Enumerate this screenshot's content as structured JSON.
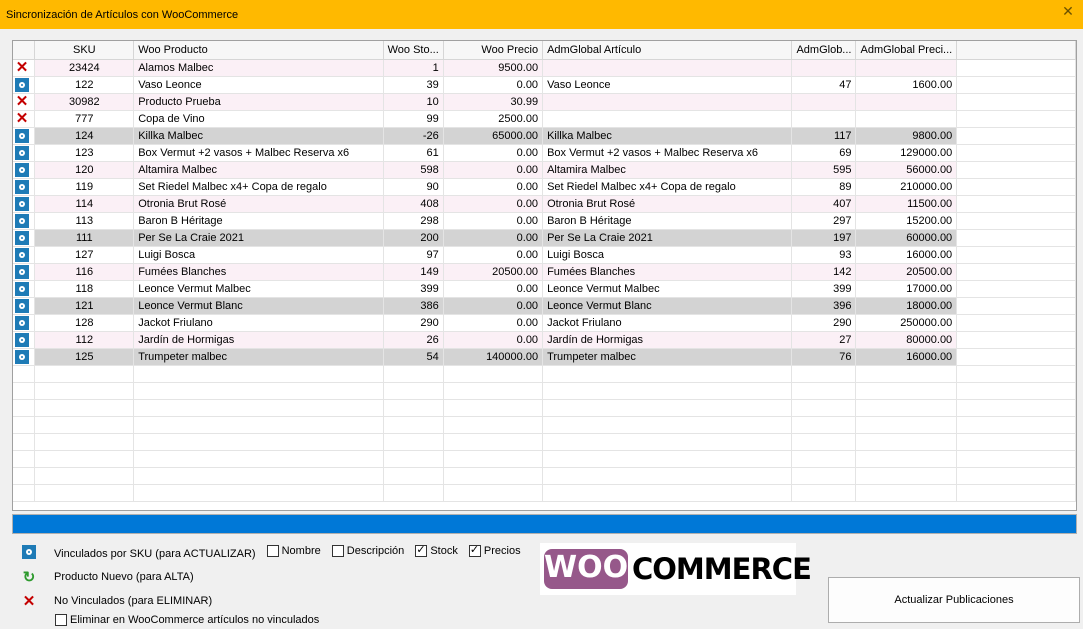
{
  "window": {
    "title": "Sincronización de Artículos con WooCommerce",
    "close": "✕"
  },
  "grid": {
    "headers": [
      "",
      "SKU",
      "Woo Producto",
      "Woo Sto...",
      "Woo Precio",
      "AdmGlobal Artículo",
      "AdmGlob...",
      "AdmGlobal Preci...",
      ""
    ],
    "rows": [
      {
        "icon": "x",
        "style": "pink",
        "cells": [
          "23424",
          "Alamos Malbec",
          "1",
          "9500.00",
          "",
          "",
          ""
        ]
      },
      {
        "icon": "link",
        "style": "white",
        "cells": [
          "122",
          "Vaso Leonce",
          "39",
          "0.00",
          "Vaso Leonce",
          "47",
          "1600.00"
        ]
      },
      {
        "icon": "x",
        "style": "pink",
        "cells": [
          "30982",
          "Producto Prueba",
          "10",
          "30.99",
          "",
          "",
          ""
        ]
      },
      {
        "icon": "x",
        "style": "white",
        "cells": [
          "777",
          "Copa de Vino",
          "99",
          "2500.00",
          "",
          "",
          ""
        ]
      },
      {
        "icon": "link",
        "style": "gray",
        "cells": [
          "124",
          "Killka Malbec",
          "-26",
          "65000.00",
          "Killka Malbec",
          "117",
          "9800.00"
        ]
      },
      {
        "icon": "link",
        "style": "white",
        "cells": [
          "123",
          "Box Vermut +2 vasos + Malbec Reserva x6",
          "61",
          "0.00",
          "Box Vermut +2 vasos + Malbec Reserva x6",
          "69",
          "129000.00"
        ]
      },
      {
        "icon": "link",
        "style": "pink",
        "cells": [
          "120",
          "Altamira Malbec",
          "598",
          "0.00",
          "Altamira Malbec",
          "595",
          "56000.00"
        ]
      },
      {
        "icon": "link",
        "style": "white",
        "cells": [
          "119",
          "Set Riedel Malbec x4+ Copa de regalo",
          "90",
          "0.00",
          "Set Riedel Malbec x4+ Copa de regalo",
          "89",
          "210000.00"
        ]
      },
      {
        "icon": "link",
        "style": "pink",
        "cells": [
          "114",
          "Otronia Brut Rosé",
          "408",
          "0.00",
          "Otronia Brut Rosé",
          "407",
          "11500.00"
        ]
      },
      {
        "icon": "link",
        "style": "white",
        "cells": [
          "113",
          "Baron B Héritage",
          "298",
          "0.00",
          "Baron B Héritage",
          "297",
          "15200.00"
        ]
      },
      {
        "icon": "link",
        "style": "gray",
        "cells": [
          "111",
          "Per Se La Craie 2021",
          "200",
          "0.00",
          "Per Se La Craie 2021",
          "197",
          "60000.00"
        ]
      },
      {
        "icon": "link",
        "style": "white",
        "cells": [
          "127",
          "Luigi Bosca",
          "97",
          "0.00",
          "Luigi Bosca",
          "93",
          "16000.00"
        ]
      },
      {
        "icon": "link",
        "style": "pink",
        "cells": [
          "116",
          "Fumées Blanches",
          "149",
          "20500.00",
          "Fumées Blanches",
          "142",
          "20500.00"
        ]
      },
      {
        "icon": "link",
        "style": "white",
        "cells": [
          "118",
          "Leonce Vermut Malbec",
          "399",
          "0.00",
          "Leonce Vermut Malbec",
          "399",
          "17000.00"
        ]
      },
      {
        "icon": "link",
        "style": "gray",
        "cells": [
          "121",
          "Leonce Vermut Blanc",
          "386",
          "0.00",
          "Leonce Vermut Blanc",
          "396",
          "18000.00"
        ]
      },
      {
        "icon": "link",
        "style": "white",
        "cells": [
          "128",
          "Jackot Friulano",
          "290",
          "0.00",
          "Jackot Friulano",
          "290",
          "250000.00"
        ]
      },
      {
        "icon": "link",
        "style": "pink",
        "cells": [
          "112",
          "Jardín de Hormigas",
          "26",
          "0.00",
          "Jardín de Hormigas",
          "27",
          "80000.00"
        ]
      },
      {
        "icon": "link",
        "style": "gray",
        "cells": [
          "125",
          "Trumpeter malbec",
          "54",
          "140000.00",
          "Trumpeter malbec",
          "76",
          "16000.00"
        ]
      }
    ],
    "empty_rows": 8
  },
  "progress": {
    "percent": 100,
    "color": "#0078d7"
  },
  "legend": {
    "linked": "Vinculados por SKU (para ACTUALIZAR)",
    "new": "Producto Nuevo (para ALTA)",
    "unlinked": "No Vinculados (para ELIMINAR)",
    "delete_option": "Eliminar en WooCommerce artículos no vinculados"
  },
  "options": [
    {
      "label": "Nombre",
      "checked": false
    },
    {
      "label": "Descripción",
      "checked": false
    },
    {
      "label": "Stock",
      "checked": true
    },
    {
      "label": "Precios",
      "checked": true
    }
  ],
  "logo": {
    "woo": "WOO",
    "commerce": "COMMERCE",
    "color": "#96588a"
  },
  "actions": {
    "update": "Actualizar Publicaciones"
  },
  "colors": {
    "titlebar": "#ffb900",
    "row_pink": "#fbf0f6",
    "row_gray": "#d3d3d3",
    "link_icon": "#1e7bb6",
    "x_icon": "#c40000"
  }
}
